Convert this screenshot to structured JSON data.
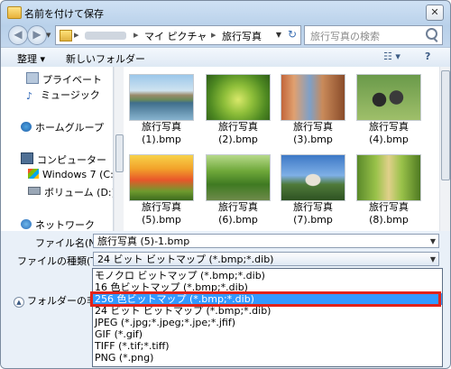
{
  "window": {
    "title": "名前を付けて保存",
    "close": "✕"
  },
  "address": {
    "segments": [
      "マイ ピクチャ",
      "旅行写真"
    ],
    "separator": "▸",
    "refresh": "↻"
  },
  "search": {
    "placeholder": "旅行写真の検索"
  },
  "toolbar": {
    "organize": "整理 ▾",
    "new_folder": "新しいフォルダー",
    "views": "☷ ▾",
    "help": "?"
  },
  "nav": {
    "items": [
      {
        "label": "プライベート"
      },
      {
        "label": "ミュージック"
      },
      {
        "label": "ホームグループ"
      },
      {
        "label": "コンピューター"
      },
      {
        "label": "Windows 7 (C:)"
      },
      {
        "label": "ボリューム (D:)"
      },
      {
        "label": "ネットワーク"
      }
    ]
  },
  "files": [
    {
      "name": "旅行写真",
      "sub": "(1).bmp",
      "thumb": "canal"
    },
    {
      "name": "旅行写真",
      "sub": "(2).bmp",
      "thumb": "bird"
    },
    {
      "name": "旅行写真",
      "sub": "(3).bmp",
      "thumb": "city"
    },
    {
      "name": "旅行写真",
      "sub": "(4).bmp",
      "thumb": "ducks"
    },
    {
      "name": "旅行写真",
      "sub": "(5).bmp",
      "thumb": "tulips"
    },
    {
      "name": "旅行写真",
      "sub": "(6).bmp",
      "thumb": "forest"
    },
    {
      "name": "旅行写真",
      "sub": "(7).bmp",
      "thumb": "castle"
    },
    {
      "name": "旅行写真",
      "sub": "(8).bmp",
      "thumb": "path"
    }
  ],
  "form": {
    "filename_label": "ファイル名(N):",
    "filename_value": "旅行写真 (5)-1.bmp",
    "filetype_label": "ファイルの種類(T):",
    "filetype_value": "24 ビット ビットマップ (*.bmp;*.dib)",
    "folder_toggle": "フォルダーの非表"
  },
  "filetype_options": [
    "モノクロ ビットマップ (*.bmp;*.dib)",
    "16 色ビットマップ (*.bmp;*.dib)",
    "256 色ビットマップ (*.bmp;*.dib)",
    "24 ビット ビットマップ (*.bmp;*.dib)",
    "JPEG (*.jpg;*.jpeg;*.jpe;*.jfif)",
    "GIF (*.gif)",
    "TIFF (*.tif;*.tiff)",
    "PNG (*.png)"
  ],
  "selected_option_index": 2,
  "colors": {
    "selection": "#3399ff",
    "highlight_box": "#e2231a"
  }
}
